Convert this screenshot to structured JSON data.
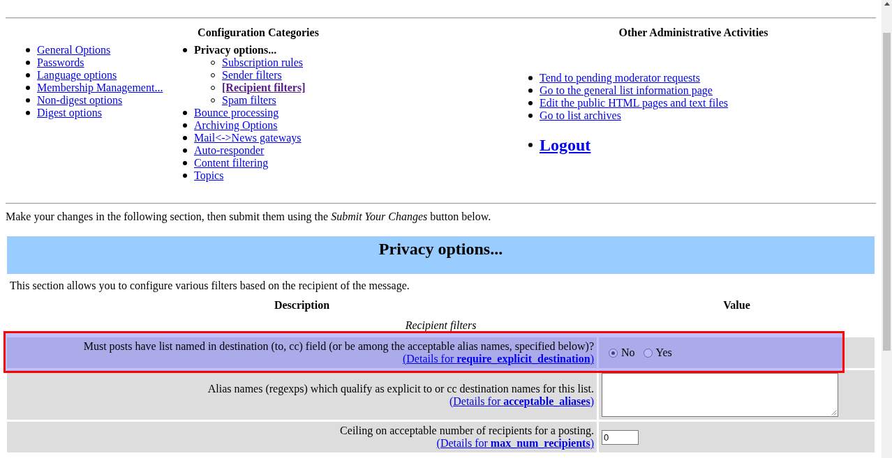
{
  "admin_nav": {
    "categories": {
      "heading": "Configuration Categories",
      "columns": [
        [
          {
            "label": "General Options",
            "selected": false
          },
          {
            "label": "Passwords",
            "selected": false
          },
          {
            "label": "Language options",
            "selected": false
          },
          {
            "label": "Membership Management...",
            "selected": false
          },
          {
            "label": "Non-digest options",
            "selected": false
          },
          {
            "label": "Digest options",
            "selected": false
          }
        ],
        [
          {
            "label": "Privacy options...",
            "selected": true,
            "children": [
              {
                "label": "Subscription rules",
                "selected": false
              },
              {
                "label": "Sender filters",
                "selected": false
              },
              {
                "label": "[Recipient filters]",
                "selected": true
              },
              {
                "label": "Spam filters",
                "selected": false
              }
            ]
          },
          {
            "label": "Bounce processing",
            "selected": false
          },
          {
            "label": "Archiving Options",
            "selected": false
          },
          {
            "label": "Mail<->News gateways",
            "selected": false
          },
          {
            "label": "Auto-responder",
            "selected": false
          },
          {
            "label": "Content filtering",
            "selected": false
          },
          {
            "label": "Topics",
            "selected": false
          }
        ]
      ]
    },
    "other_activities": {
      "heading": "Other Administrative Activities",
      "links": [
        {
          "kind": "link",
          "label": "Tend to pending moderator requests"
        },
        {
          "kind": "link",
          "label": "Go to the general list information page"
        },
        {
          "kind": "link",
          "label": "Edit the public HTML pages and text files"
        },
        {
          "kind": "link",
          "label": "Go to list archives"
        },
        {
          "kind": "logout",
          "label": "Logout"
        }
      ]
    }
  },
  "instructions": "Make your changes in the following section, then submit them using the *Submit Your Changes* button below.",
  "section": {
    "title": "Privacy options...",
    "description": "This section allows you to configure various filters based on the recipient of the message.",
    "columns": [
      "Description",
      "Value"
    ],
    "group": "Recipient filters",
    "rows": [
      {
        "kind": "radio",
        "highlighted": true,
        "description": "Must posts have list named in destination (to, cc) field (or be among the acceptable alias names, specified below)?",
        "details": "(Details for **require_explicit_destination**)",
        "options": [
          {
            "label": "No",
            "selected": true
          },
          {
            "label": "Yes",
            "selected": false
          }
        ]
      },
      {
        "kind": "textarea",
        "highlighted": false,
        "description": "Alias names (regexps) which qualify as explicit to or cc destination names for this list.",
        "details": "(Details for **acceptable_aliases**)"
      },
      {
        "kind": "number",
        "highlighted": false,
        "description": "Ceiling on acceptable number of recipients for a posting.",
        "details": "(Details for **max_num_recipients**)",
        "value": "0"
      }
    ]
  }
}
